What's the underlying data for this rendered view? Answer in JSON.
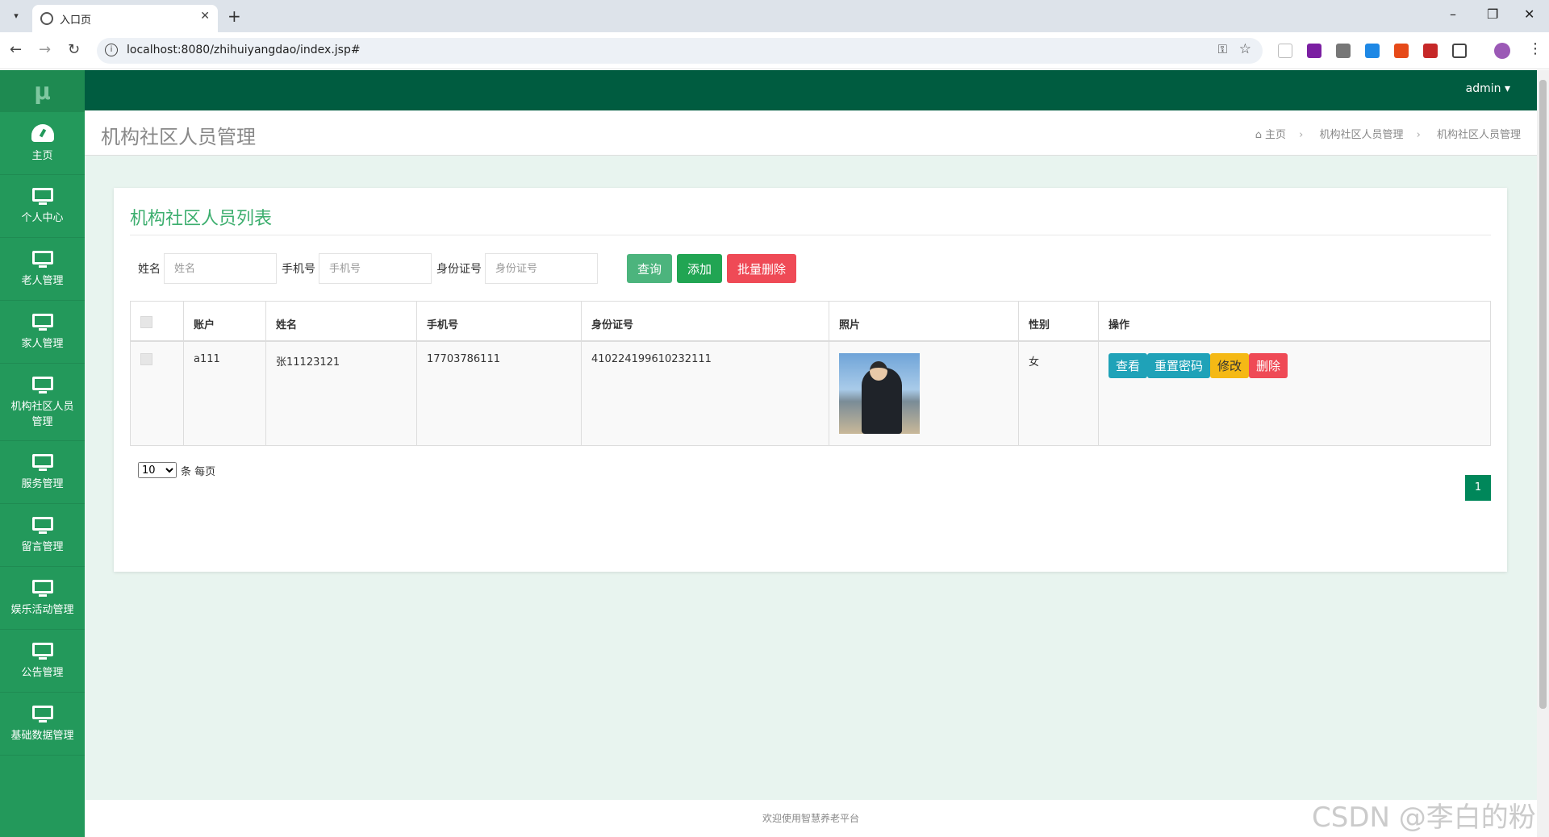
{
  "browser": {
    "tab_title": "入口页",
    "url": "localhost:8080/zhihuiyangdao/index.jsp#"
  },
  "app": {
    "brand": "μ",
    "user": "admin ▾",
    "page_title": "机构社区人员管理",
    "breadcrumb": [
      "主页",
      "机构社区人员管理",
      "机构社区人员管理"
    ],
    "sidebar": [
      {
        "label": "主页",
        "icon": "dashboard-icon"
      },
      {
        "label": "个人中心",
        "icon": "monitor-icon"
      },
      {
        "label": "老人管理",
        "icon": "monitor-icon"
      },
      {
        "label": "家人管理",
        "icon": "monitor-icon"
      },
      {
        "label": "机构社区人员管理",
        "icon": "monitor-icon"
      },
      {
        "label": "服务管理",
        "icon": "monitor-icon"
      },
      {
        "label": "留言管理",
        "icon": "monitor-icon"
      },
      {
        "label": "娱乐活动管理",
        "icon": "monitor-icon"
      },
      {
        "label": "公告管理",
        "icon": "monitor-icon"
      },
      {
        "label": "基础数据管理",
        "icon": "monitor-icon"
      }
    ],
    "card_title": "机构社区人员列表",
    "filters": {
      "name_label": "姓名",
      "name_placeholder": "姓名",
      "phone_label": "手机号",
      "phone_placeholder": "手机号",
      "id_label": "身份证号",
      "id_placeholder": "身份证号"
    },
    "buttons": {
      "search": "查询",
      "add": "添加",
      "batch_delete": "批量删除"
    },
    "table": {
      "headers": [
        "账户",
        "姓名",
        "手机号",
        "身份证号",
        "照片",
        "性别",
        "操作"
      ],
      "rows": [
        {
          "account": "a111",
          "name": "张11123121",
          "phone": "17703786111",
          "id_number": "410224199610232111",
          "gender": "女"
        }
      ],
      "actions": {
        "view": "查看",
        "reset": "重置密码",
        "edit": "修改",
        "delete": "删除"
      }
    },
    "pager": {
      "size": "10",
      "size_suffix": "条 每页",
      "current": "1"
    },
    "footer": "欢迎使用智慧养老平台",
    "watermark": "CSDN @李白的粉"
  },
  "colors": {
    "sidebar": "#23995b",
    "topbar": "#005c40",
    "accent": "#3cae6e"
  }
}
